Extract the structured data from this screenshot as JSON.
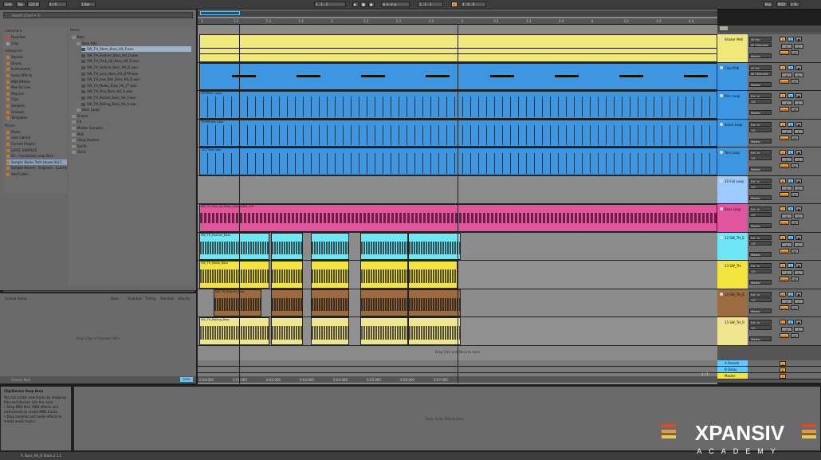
{
  "transport": {
    "link": "Link",
    "tap": "Tap",
    "tempo": "122.00",
    "time_sig": "4 / 4",
    "quantize": "1 Bar",
    "position": "1 . 1 . 1",
    "loop_start": "1 . 1 . 1",
    "loop_len": "4 . 0 . 0",
    "key": "Key",
    "midi": "MIDI",
    "cpu": "3 %"
  },
  "browser": {
    "search_placeholder": "Search (Cmd + F)",
    "collections_label": "Collections",
    "collections": [
      "Favorites",
      "Gray"
    ],
    "categories_label": "Categories",
    "categories": [
      "Sounds",
      "Drums",
      "Instruments",
      "Audio Effects",
      "MIDI Effects",
      "Max for Live",
      "Plug-ins",
      "Clips",
      "Samples",
      "Grooves",
      "Templates"
    ],
    "places_label": "Places",
    "places": [
      "Packs",
      "User Library",
      "Current Project",
      "LOGIC SAMPLES",
      "EA - Foundation Loop Pack",
      "Sample Works Tech House Vol.1",
      "Sample Market - Originals - Cuartel",
      "Add Folder..."
    ],
    "name_header": "Name",
    "tree": [
      {
        "label": "Bass",
        "depth": 0
      },
      {
        "label": "Bass Hits",
        "depth": 1
      },
      {
        "label": "SW_TH_Atom_Bass_Hit_F.wav",
        "depth": 2
      },
      {
        "label": "SW_TH_Evolner_Bass_Hit_D.wav",
        "depth": 2
      },
      {
        "label": "SW_TH_Flick_Up_Bass_Hit_D.wav",
        "depth": 2
      },
      {
        "label": "SW_TH_Gotcha_Bass_Hit_D.wav",
        "depth": 2
      },
      {
        "label": "SW_TH_Loco_Bass_Hit_D*M.wav",
        "depth": 2
      },
      {
        "label": "SW_TH_Low_Ball_Bass_Hit_D.wav",
        "depth": 2
      },
      {
        "label": "SW_TH_Molko_Bass_Hit_C*.wav",
        "depth": 2
      },
      {
        "label": "SW_TH_Pico_Bass_Hit_D.wav",
        "depth": 2
      },
      {
        "label": "SW_TH_Rocket_Bass_Hit_F.wav",
        "depth": 2
      },
      {
        "label": "SW_TH_Rolling_Bass_Hit_A.wav",
        "depth": 2
      },
      {
        "label": "Bass Loops",
        "depth": 1
      },
      {
        "label": "Drums",
        "depth": 0
      },
      {
        "label": "FX",
        "depth": 0
      },
      {
        "label": "Master Samples",
        "depth": 0
      },
      {
        "label": "Midi",
        "depth": 0
      },
      {
        "label": "Song Starters",
        "depth": 0
      },
      {
        "label": "Synth",
        "depth": 0
      },
      {
        "label": "Vocal",
        "depth": 0
      }
    ],
    "preview_label": "Raw"
  },
  "groove_pool": {
    "headers": [
      "Groove Name",
      "Base",
      "Quantize",
      "Timing",
      "Random",
      "Velocity"
    ],
    "drop_text": "Drop Clips or Grooves Here",
    "global_amount_label": "Global Amount",
    "global_amount_value": "100%",
    "footer": "Groove Pool"
  },
  "ruler": {
    "bars": [
      "1",
      "1.2",
      "1.3",
      "1.4",
      "2",
      "2.2",
      "2.3",
      "2.4",
      "3",
      "3.2",
      "3.3",
      "3.4",
      "4",
      "4.2",
      "4.3",
      "4.4"
    ],
    "times": [
      "0:00:000",
      "0:01:000",
      "0:02:000",
      "0:03:000",
      "0:04:000",
      "0:05:000",
      "0:06:000",
      "0:07:000"
    ]
  },
  "tracks": [
    {
      "name": "Shaker Midi",
      "input": "All Ins",
      "chan": "All Channels",
      "out": "Master",
      "num": "1",
      "color": "#f0e97a",
      "clip": ""
    },
    {
      "name": "Clap Midi",
      "input": "All Ins",
      "chan": "All Channels",
      "out": "Master",
      "num": "2",
      "color": "#3d96e0",
      "clip": ""
    },
    {
      "name": "Perc Loop",
      "input": "Ext. In",
      "chan": "1/2",
      "out": "Master",
      "num": "3",
      "color": "#3d96e0",
      "clip": "3939Perc Loop"
    },
    {
      "name": "Snare Loop",
      "input": "Ext. In",
      "chan": "1/2",
      "out": "Master",
      "num": "4",
      "color": "#3d96e0",
      "clip": "3939Snare Loop"
    },
    {
      "name": "Tom Loop",
      "input": "Ext. In",
      "chan": "1/2",
      "out": "Master",
      "num": "5",
      "color": "#3d96e0",
      "clip": "1317Tom Loop"
    },
    {
      "name": "10 Full Loop",
      "input": "Ext. In",
      "chan": "1/2",
      "out": "Master",
      "num": "6",
      "color": "#9ecbff",
      "clip": ""
    },
    {
      "name": "Bass Loop",
      "input": "Ext. In",
      "chan": "1/2",
      "out": "Master",
      "num": "7",
      "color": "#e0559b",
      "clip": "SW_TH_Pico_Up_Bass_Loop_D#M_125"
    },
    {
      "name": "12 SW_TH_E",
      "input": "Ext. In",
      "chan": "1/2",
      "out": "Master",
      "num": "8",
      "color": "#6fe6f5",
      "clip": "SW_TH_Evolner_Bass"
    },
    {
      "name": "13 SW_TH",
      "input": "Ext. In",
      "chan": "1/2",
      "out": "Master",
      "num": "9",
      "color": "#f2e43c",
      "clip": "SW_TH_Molko_Bass"
    },
    {
      "name": "14 SW_TH_E",
      "input": "Ext. In",
      "chan": "1/2",
      "out": "Master",
      "num": "10",
      "color": "#9c6b3f",
      "clip": "SW_TH_Evolner_Bass"
    },
    {
      "name": "15 SW_TH_R",
      "input": "Ext. In",
      "chan": "1/2",
      "out": "Master",
      "num": "11",
      "color": "#eee58e",
      "clip": "SW_TH_Rolling_Bass"
    }
  ],
  "drop_files_text": "Drop Files and Devices Here",
  "returns": [
    {
      "name": "A Reverb",
      "num": "A",
      "color": "#5ec8ff"
    },
    {
      "name": "B Delay",
      "num": "B",
      "color": "#5ec8ff"
    },
    {
      "name": "Master",
      "num": "0",
      "color": "#f2e43c"
    }
  ],
  "page_counter": "1 / 1",
  "info_view": {
    "title": "Clip/Device Drop Area",
    "lines": [
      "You can create new tracks by dropping",
      "files and devices into this area.",
      "• Drop MIDI files, MIDI effects and",
      "instruments to create MIDI tracks.",
      "• Drop samples and audio effects to",
      "create audio tracks."
    ]
  },
  "device_drop_text": "Drop Audio Effects Here",
  "status_text": "R. Bass_Hit_D.Stack 2.1.1",
  "logo": {
    "brand": "XPANSIV",
    "sub": "ACADEMY"
  }
}
